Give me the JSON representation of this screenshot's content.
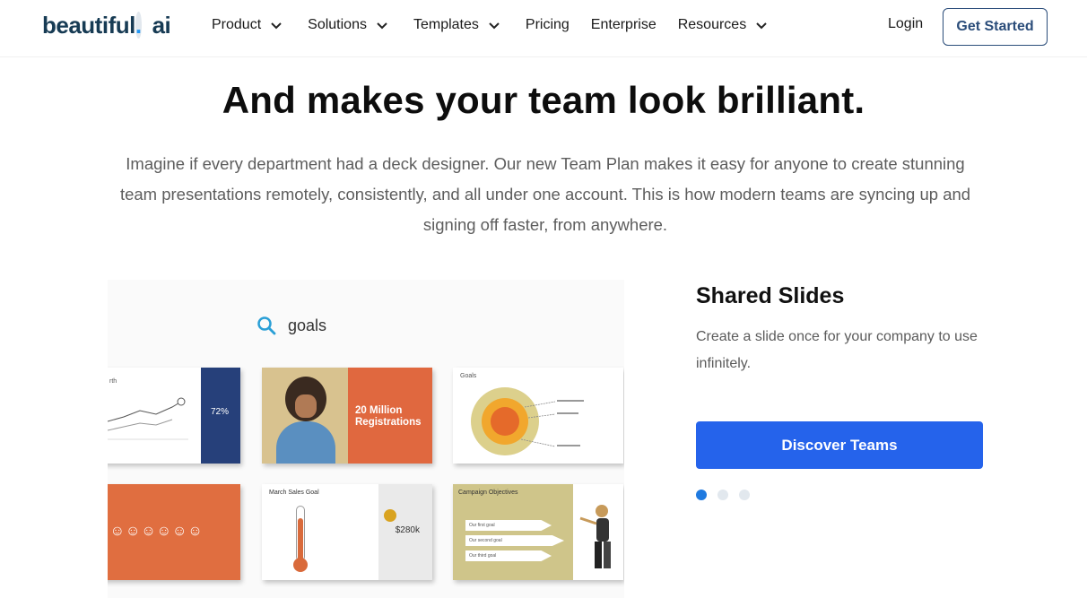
{
  "header": {
    "logo_main": "beautiful",
    "logo_dot": ".",
    "logo_suffix": "ai",
    "nav": [
      {
        "label": "Product",
        "has_dropdown": true
      },
      {
        "label": "Solutions",
        "has_dropdown": true
      },
      {
        "label": "Templates",
        "has_dropdown": true
      },
      {
        "label": "Pricing",
        "has_dropdown": false
      },
      {
        "label": "Enterprise",
        "has_dropdown": false
      },
      {
        "label": "Resources",
        "has_dropdown": true
      }
    ],
    "login_label": "Login",
    "cta_label": "Get Started"
  },
  "hero": {
    "title": "And makes your team look brilliant.",
    "subtitle": "Imagine if every department had a deck designer. Our new Team Plan makes it easy for anyone to create stunning team presentations remotely, consistently, and all under one account. This is how modern teams are syncing up and signing off faster, from anywhere."
  },
  "showcase": {
    "search_query": "goals",
    "cards": [
      {
        "label": "rth",
        "stat": "72%"
      },
      {
        "title": "20 Million Registrations"
      },
      {
        "label": "Goals"
      },
      {
        "faces": "% ☺☺☺☺☺☺"
      },
      {
        "label": "March Sales Goal",
        "value": "$280k"
      },
      {
        "label": "Campaign Objectives",
        "items": [
          "Our first goal",
          "Our second goal",
          "Our third goal"
        ]
      }
    ]
  },
  "feature": {
    "title": "Shared Slides",
    "description": "Create a slide once for your company to use infinitely.",
    "button_label": "Discover Teams",
    "carousel": {
      "count": 3,
      "active_index": 0
    }
  },
  "colors": {
    "brand": "#173b54",
    "accent": "#2563eb",
    "orange": "#e0683f"
  }
}
